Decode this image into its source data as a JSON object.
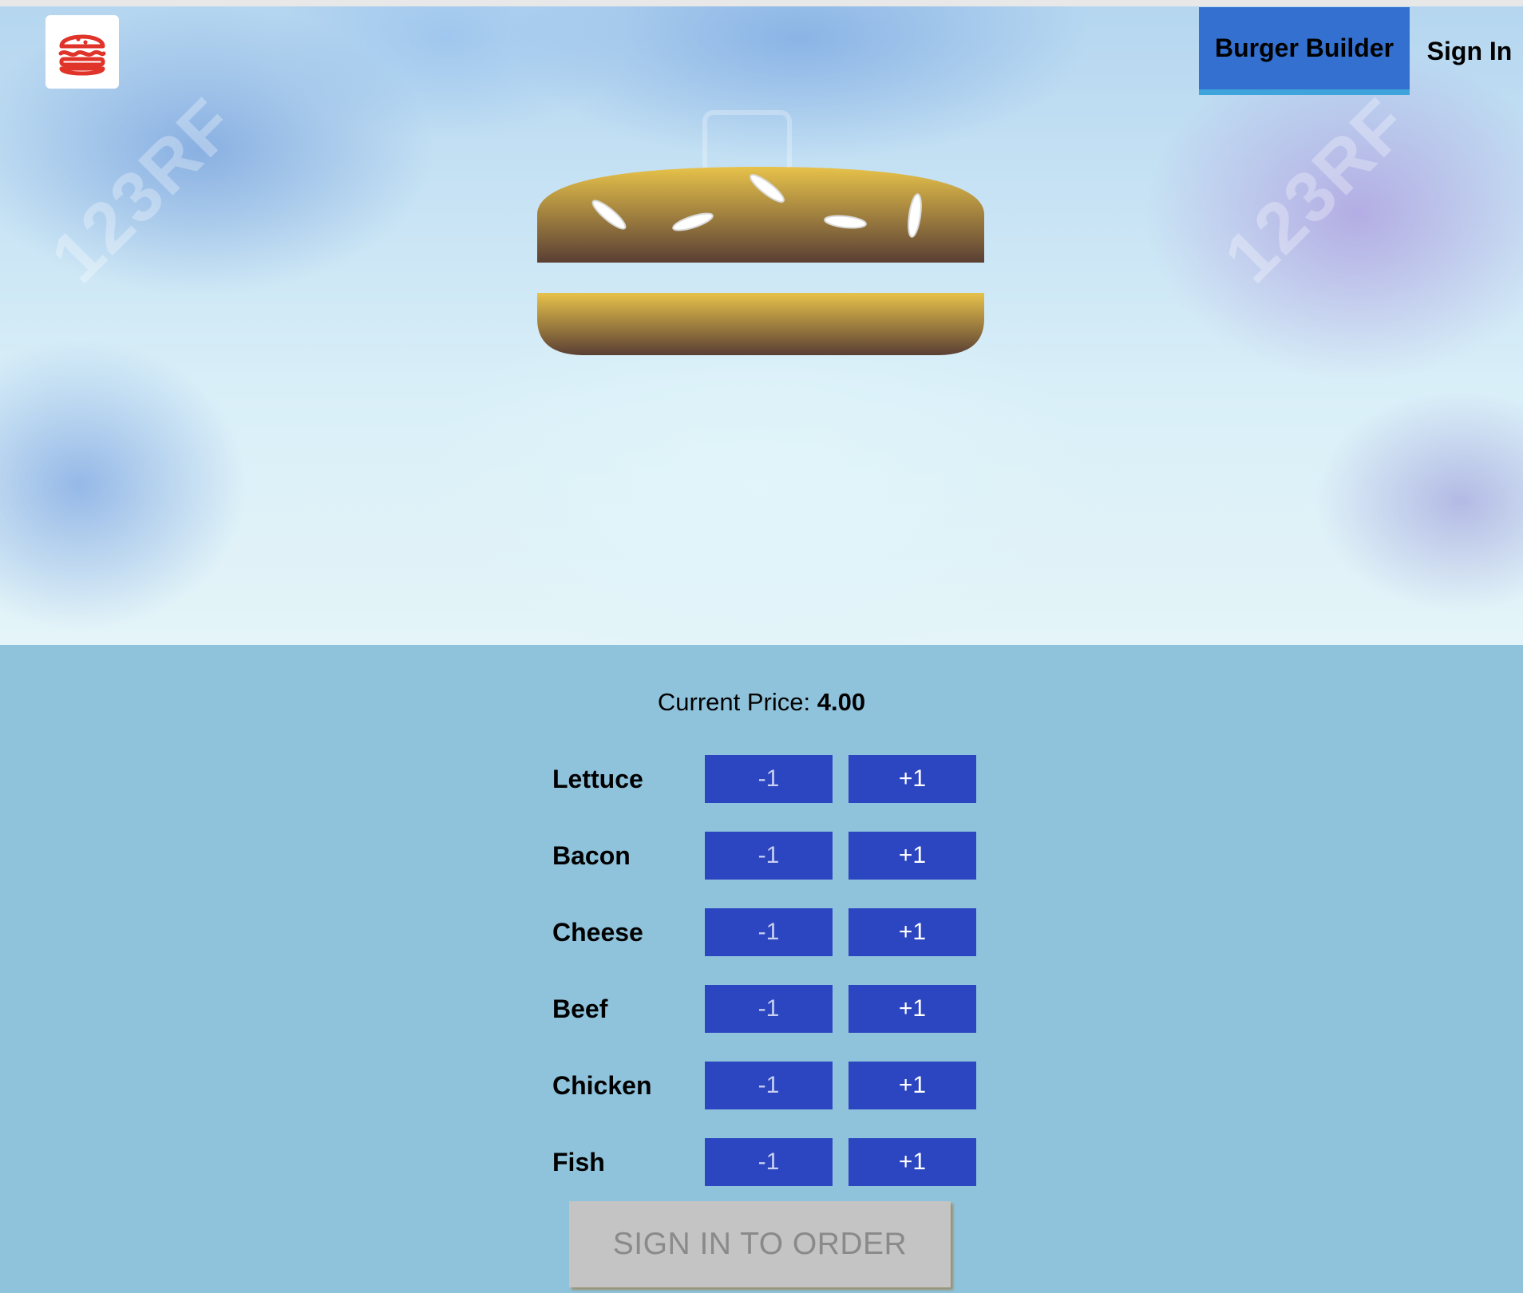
{
  "header": {
    "logo_icon": "burger-logo-icon",
    "nav": [
      {
        "label": "Burger Builder",
        "active": true
      },
      {
        "label": "Sign In",
        "active": false
      }
    ]
  },
  "hero": {
    "watermark": "123RF"
  },
  "build_controls": {
    "price_label": "Current Price:",
    "price_value": "4.00",
    "less_label": "-1",
    "more_label": "+1",
    "ingredients": [
      "Lettuce",
      "Bacon",
      "Cheese",
      "Beef",
      "Chicken",
      "Fish"
    ],
    "order_button": "SIGN IN TO ORDER"
  },
  "colors": {
    "button_blue": "#2b46c0",
    "nav_active": "#3370d0",
    "controls_bg": "#8fc3dc",
    "logo_red": "#e0342a"
  }
}
